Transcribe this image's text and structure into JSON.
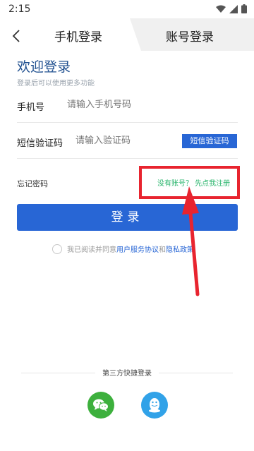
{
  "status_bar": {
    "time": "2:15"
  },
  "tabs": {
    "phone_login": "手机登录",
    "account_login": "账号登录"
  },
  "welcome": {
    "title": "欢迎登录",
    "subtitle": "登录后可以使用更多功能"
  },
  "phone_field": {
    "label": "手机号",
    "placeholder": "请输入手机号码"
  },
  "sms_field": {
    "label": "短信验证码",
    "placeholder": "请输入验证码",
    "button": "短信验证码"
  },
  "forgot_password": "忘记密码",
  "register_link": "没有账号？ 先点我注册",
  "login_button": "登录",
  "agreement": {
    "prefix": "我已阅读并同意",
    "service_link": "用户服务协议",
    "and": "和",
    "privacy_link": "隐私政策"
  },
  "third_party": {
    "label": "第三方快捷登录"
  },
  "colors": {
    "primary": "#2866d5",
    "title_blue": "#1f4f8f",
    "register_green": "#29b56c",
    "highlight_red": "#e8242f",
    "wechat_green": "#3db03d",
    "qq_blue": "#31a2e8"
  },
  "icons": {
    "back": "back-arrow-icon",
    "wechat": "wechat-icon",
    "qq": "qq-icon",
    "wifi": "wifi-icon",
    "signal": "signal-icon",
    "battery": "battery-icon"
  }
}
